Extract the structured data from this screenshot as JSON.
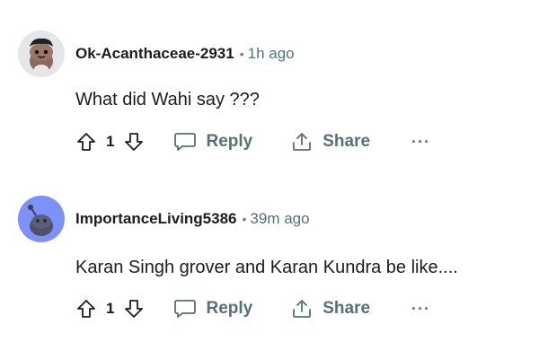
{
  "comments": [
    {
      "username": "Ok-Acanthaceae-2931",
      "separator": "•",
      "time": "1h ago",
      "text": "What did Wahi say ???",
      "score": "1",
      "reply_label": "Reply",
      "share_label": "Share",
      "more_label": "···",
      "avatar": "snoo-avatar-custom",
      "icons": [
        "upvote-icon",
        "downvote-icon",
        "reply-bubble-icon",
        "share-icon",
        "more-icon"
      ]
    },
    {
      "username": "ImportanceLiving5386",
      "separator": "•",
      "time": "39m ago",
      "text": "Karan Singh grover and Karan Kundra be like....",
      "score": "1",
      "reply_label": "Reply",
      "share_label": "Share",
      "more_label": "···",
      "avatar": "snoo-avatar-default",
      "icons": [
        "upvote-icon",
        "downvote-icon",
        "reply-bubble-icon",
        "share-icon",
        "more-icon"
      ]
    }
  ],
  "colors": {
    "meta_gray": "#576f76",
    "text": "#1c1c1c",
    "avatar2_bg": "#7e91f8"
  }
}
